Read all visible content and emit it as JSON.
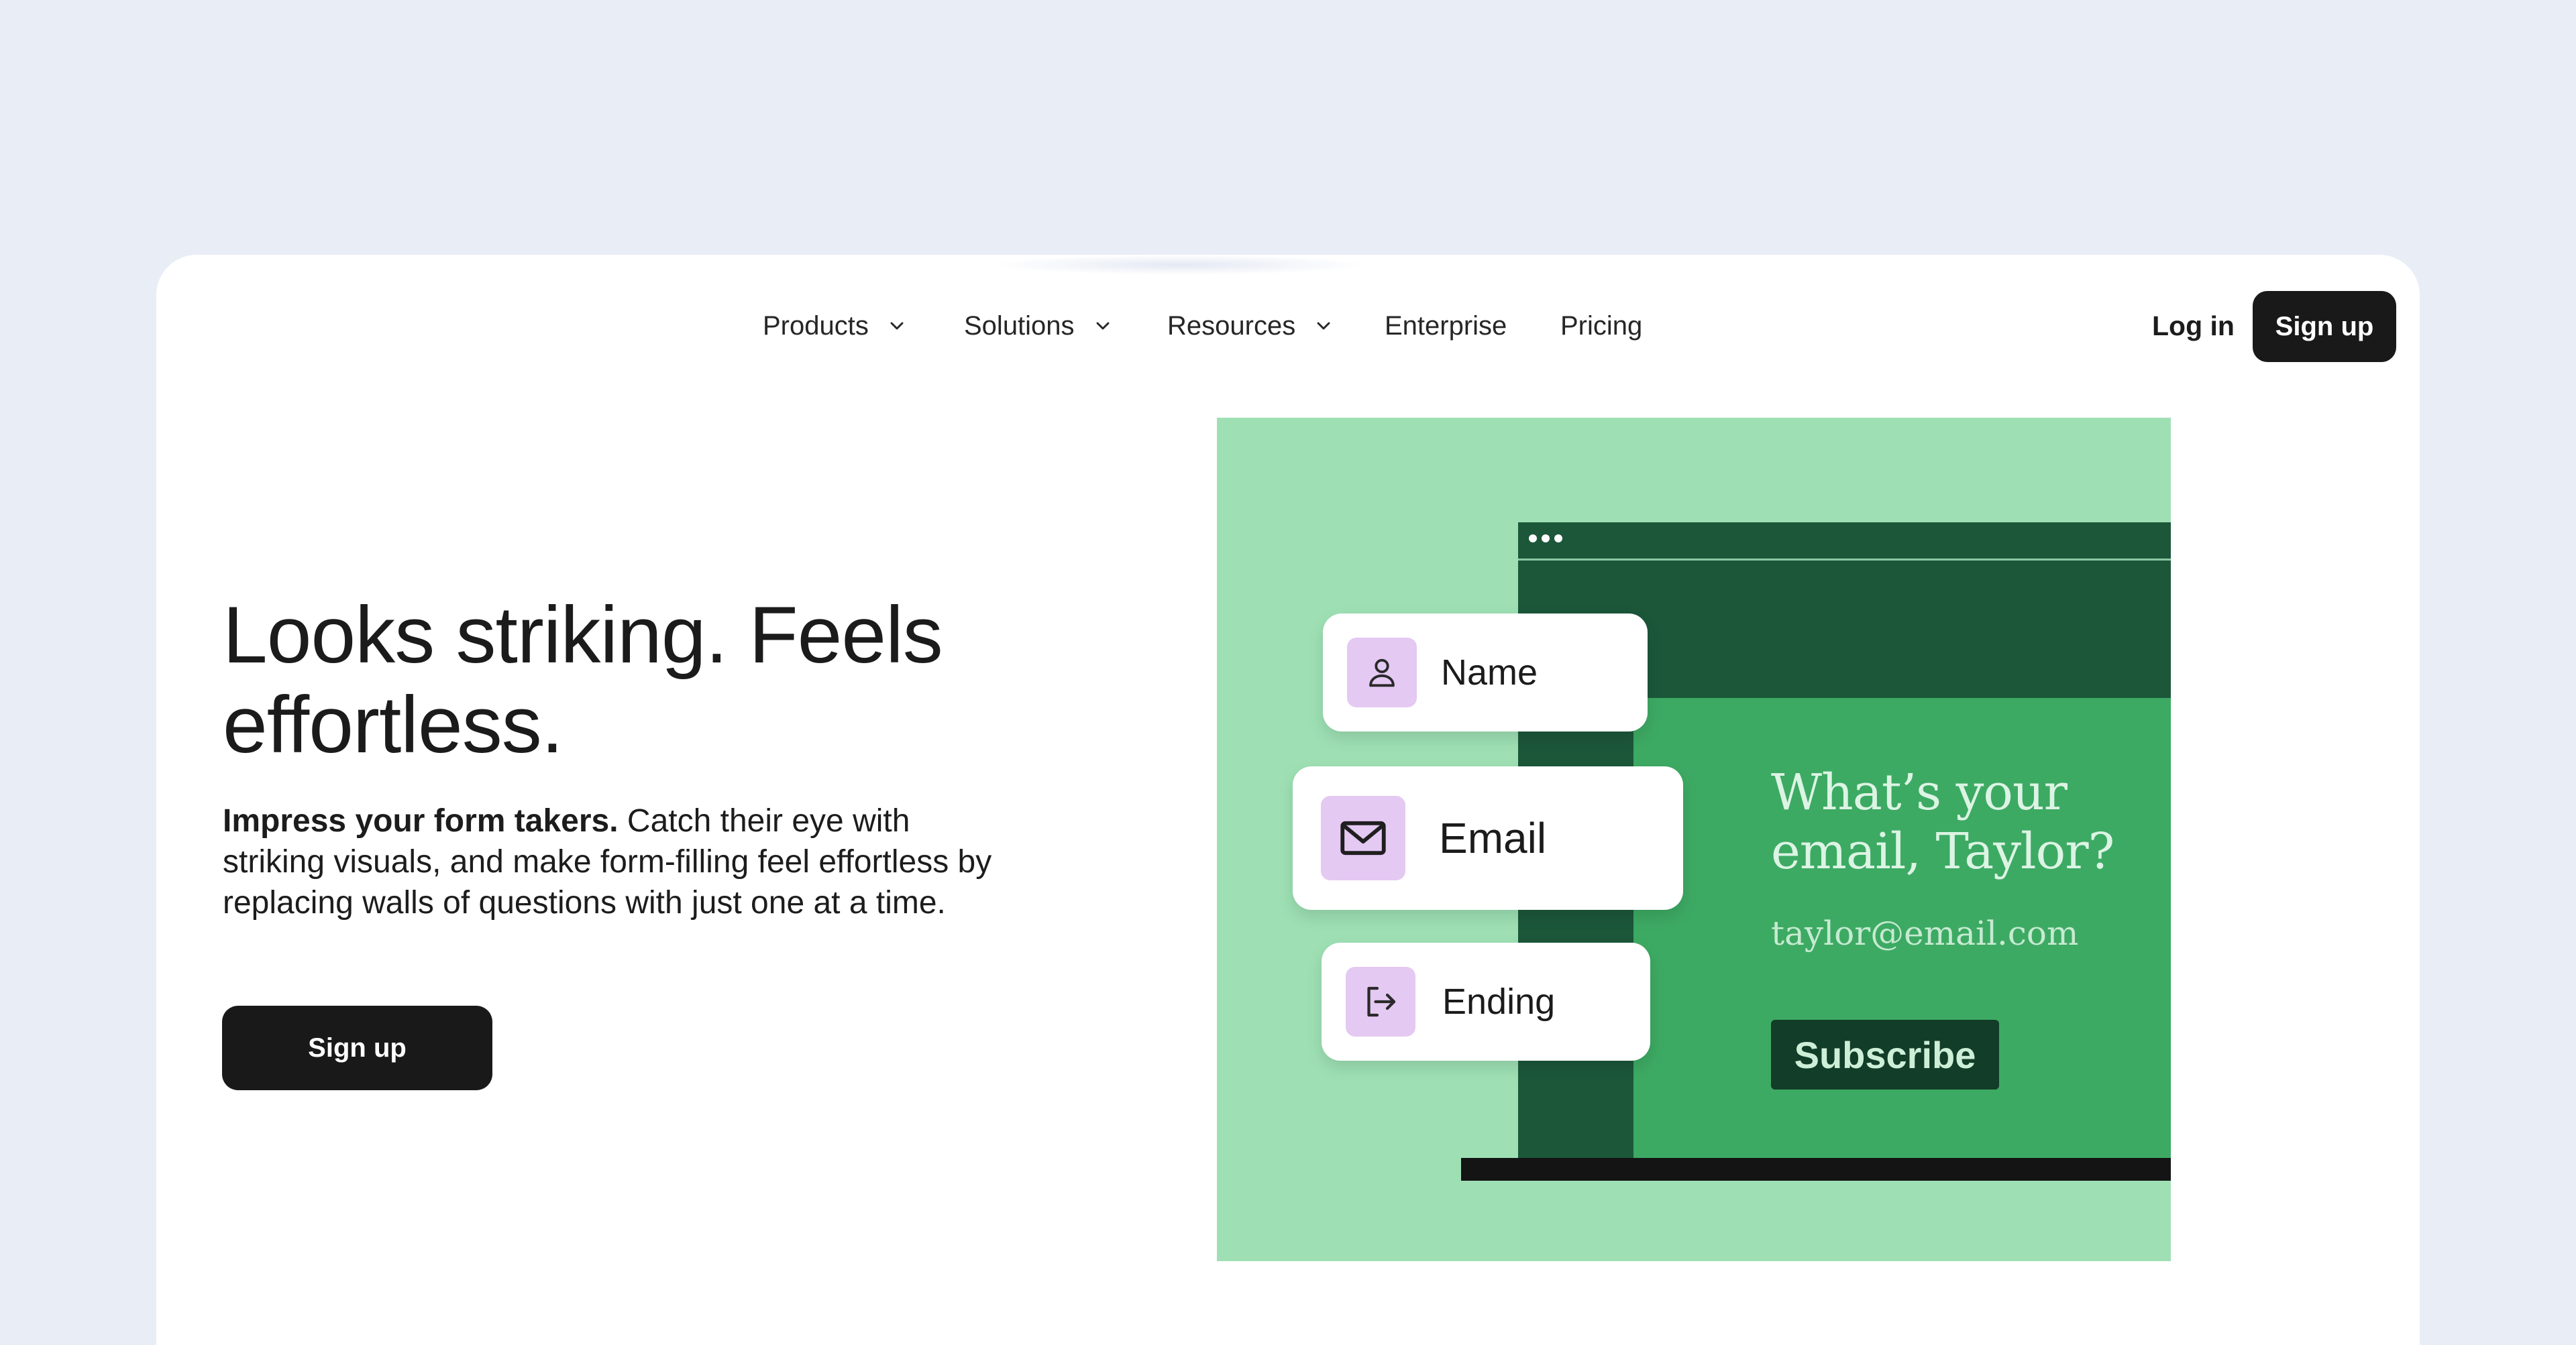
{
  "nav": {
    "items": [
      {
        "label": "Products",
        "has_dropdown": true
      },
      {
        "label": "Solutions",
        "has_dropdown": true
      },
      {
        "label": "Resources",
        "has_dropdown": true
      },
      {
        "label": "Enterprise",
        "has_dropdown": false
      },
      {
        "label": "Pricing",
        "has_dropdown": false
      }
    ],
    "login_label": "Log in",
    "signup_label": "Sign up"
  },
  "hero": {
    "title": "Looks striking. Feels effortless.",
    "body_bold": "Impress your form takers.",
    "body_rest": " Catch their eye with striking visuals, and make form-filling feel effortless by replacing walls of questions with just one at a time.",
    "cta_label": "Sign up"
  },
  "illustration": {
    "chips": [
      {
        "label": "Name",
        "icon": "person-icon"
      },
      {
        "label": "Email",
        "icon": "envelope-icon"
      },
      {
        "label": "Ending",
        "icon": "exit-icon"
      }
    ],
    "question": "What’s your email, Taylor?",
    "answer": "taylor@email.com",
    "button_label": "Subscribe"
  },
  "colors": {
    "background": "#e9edf6",
    "card": "#ffffff",
    "button_dark": "#191919",
    "illustration_bg": "#9ee0b4",
    "window_green": "#3daa63",
    "window_dark_green": "#1c573a",
    "icon_tile": "#e4c9f3"
  }
}
